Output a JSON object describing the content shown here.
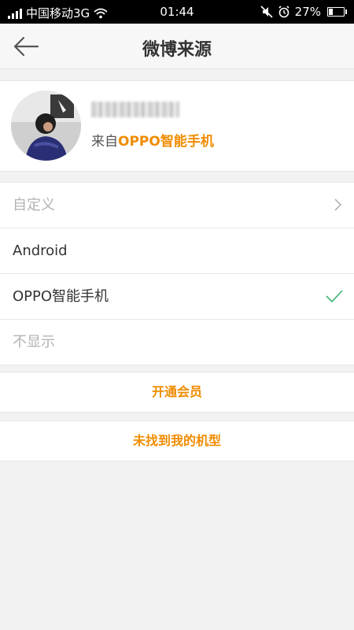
{
  "status_bar": {
    "carrier": "中国移动3G",
    "time": "01:44",
    "battery": "27%",
    "battery_level": 0.27
  },
  "header": {
    "title": "微博来源"
  },
  "profile": {
    "source_prefix": "来自",
    "source_device": "OPPO智能手机"
  },
  "options": [
    {
      "label": "自定义",
      "state": "disabled",
      "trailing": "chevron-right-icon"
    },
    {
      "label": "Android",
      "state": "normal",
      "trailing": ""
    },
    {
      "label": "OPPO智能手机",
      "state": "selected",
      "trailing": "checkmark-icon"
    },
    {
      "label": "不显示",
      "state": "disabled",
      "trailing": ""
    }
  ],
  "actions": {
    "open_vip": "开通会员",
    "model_not_found": "未找到我的机型"
  },
  "colors": {
    "accent": "#f08c00",
    "check": "#3cb371",
    "disabled_text": "#b3b3b3"
  }
}
